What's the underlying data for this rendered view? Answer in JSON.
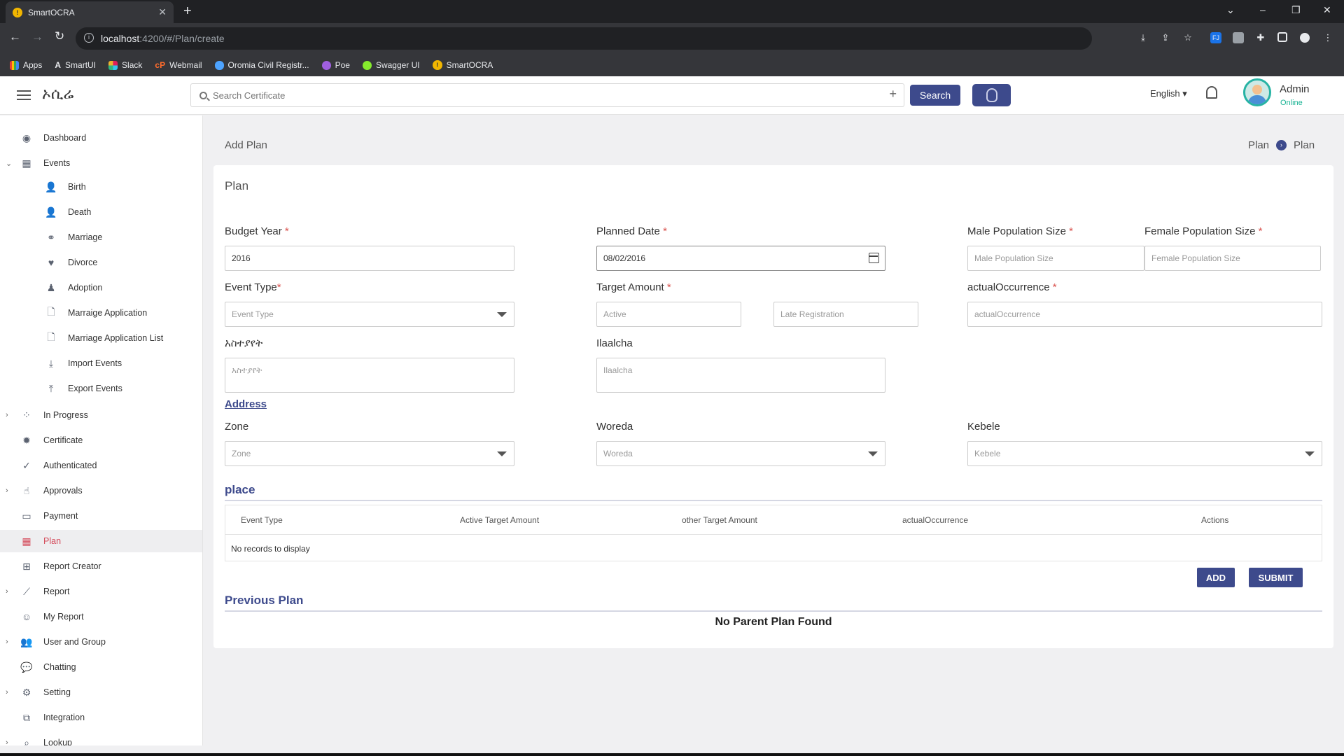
{
  "browser": {
    "tab_title": "SmartOCRA",
    "url_host": "localhost",
    "url_path": ":4200/#/Plan/create",
    "bookmarks": [
      "Apps",
      "SmartUI",
      "Slack",
      "Webmail",
      "Oromia Civil Registr...",
      "Poe",
      "Swagger UI",
      "SmartOCRA"
    ]
  },
  "header": {
    "logo_text": "ኦሲሬ",
    "search_placeholder": "Search Certificate",
    "search_button": "Search",
    "language": "English",
    "user_name": "Admin",
    "user_status": "Online"
  },
  "sidebar": {
    "items": [
      {
        "label": "Dashboard",
        "icon": "dashboard-icon"
      },
      {
        "label": "Events",
        "icon": "calendar-icon"
      },
      {
        "label": "Birth",
        "icon": "user-plus-icon"
      },
      {
        "label": "Death",
        "icon": "user-x-icon"
      },
      {
        "label": "Marriage",
        "icon": "rings-icon"
      },
      {
        "label": "Divorce",
        "icon": "broken-heart-icon"
      },
      {
        "label": "Adoption",
        "icon": "child-icon"
      },
      {
        "label": "Marraige Application",
        "icon": "file-icon"
      },
      {
        "label": "Marriage Application List",
        "icon": "file-icon"
      },
      {
        "label": "Import Events",
        "icon": "download-icon"
      },
      {
        "label": "Export Events",
        "icon": "upload-icon"
      },
      {
        "label": "In Progress",
        "icon": "spinner-icon"
      },
      {
        "label": "Certificate",
        "icon": "badge-icon"
      },
      {
        "label": "Authenticated",
        "icon": "check-circle-icon"
      },
      {
        "label": "Approvals",
        "icon": "thumbs-up-icon"
      },
      {
        "label": "Payment",
        "icon": "credit-card-icon"
      },
      {
        "label": "Plan",
        "icon": "calendar-icon"
      },
      {
        "label": "Report Creator",
        "icon": "plus-square-icon"
      },
      {
        "label": "Report",
        "icon": "chart-line-icon"
      },
      {
        "label": "My Report",
        "icon": "smile-icon"
      },
      {
        "label": "User and Group",
        "icon": "users-icon"
      },
      {
        "label": "Chatting",
        "icon": "chat-icon"
      },
      {
        "label": "Setting",
        "icon": "gear-icon"
      },
      {
        "label": "Integration",
        "icon": "external-link-icon"
      },
      {
        "label": "Lookup",
        "icon": "search-icon"
      }
    ]
  },
  "page": {
    "title": "Add Plan",
    "breadcrumb": [
      "Plan",
      "Plan"
    ],
    "card_title": "Plan"
  },
  "form": {
    "budget_year": {
      "label": "Budget Year",
      "value": "2016"
    },
    "planned_date": {
      "label": "Planned Date",
      "value": "08/02/2016"
    },
    "male_population": {
      "label": "Male Population Size",
      "placeholder": "Male Population Size"
    },
    "female_population": {
      "label": "Female Population Size",
      "placeholder": "Female Population Size"
    },
    "event_type": {
      "label": "Event Type",
      "placeholder": "Event Type"
    },
    "target_amount": {
      "label": "Target Amount",
      "active_placeholder": "Active",
      "late_placeholder": "Late Registration"
    },
    "actual_occurrence": {
      "label": "actualOccurrence",
      "placeholder": "actualOccurrence"
    },
    "remark_am": {
      "label": "አስተያየት",
      "placeholder": "አስተያየት"
    },
    "remark_om": {
      "label": "Ilaalcha",
      "placeholder": "Ilaalcha"
    },
    "address_link": "Address",
    "zone": {
      "label": "Zone",
      "placeholder": "Zone"
    },
    "woreda": {
      "label": "Woreda",
      "placeholder": "Woreda"
    },
    "kebele": {
      "label": "Kebele",
      "placeholder": "Kebele"
    }
  },
  "place": {
    "heading": "place",
    "columns": [
      "Event Type",
      "Active Target Amount",
      "other Target Amount",
      "actualOccurrence",
      "Actions"
    ],
    "empty_text": "No records to display",
    "add_button": "ADD",
    "submit_button": "SUBMIT"
  },
  "previous_plan": {
    "heading": "Previous Plan",
    "empty_text": "No Parent Plan Found"
  },
  "colors": {
    "primary": "#3d4a8c",
    "active_menu": "#d44a5a",
    "online": "#19b394"
  }
}
